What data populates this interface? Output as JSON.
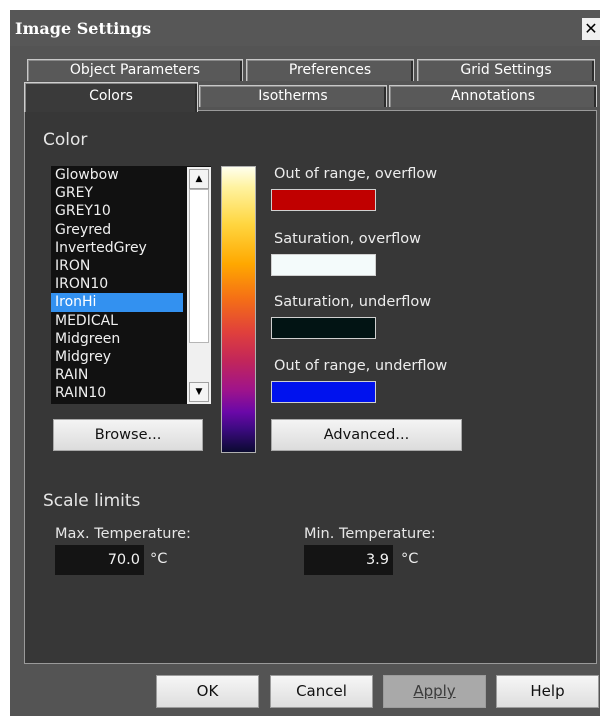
{
  "window": {
    "title": "Image Settings",
    "close_label": "✕"
  },
  "tabs_row1": [
    {
      "label": "Object Parameters"
    },
    {
      "label": "Preferences"
    },
    {
      "label": "Grid Settings"
    }
  ],
  "tabs_row2": [
    {
      "label": "Colors",
      "active": true
    },
    {
      "label": "Isotherms"
    },
    {
      "label": "Annotations"
    }
  ],
  "color_section": {
    "title": "Color",
    "palettes": [
      "Glowbow",
      "GREY",
      "GREY10",
      "Greyred",
      "InvertedGrey",
      "IRON",
      "IRON10",
      "IronHi",
      "MEDICAL",
      "Midgreen",
      "Midgrey",
      "RAIN",
      "RAIN10"
    ],
    "selected_palette": "IronHi",
    "scroll_up_icon": "▲",
    "scroll_down_icon": "▼",
    "browse_label": "Browse...",
    "advanced_label": "Advanced...",
    "swatches": [
      {
        "label": "Out of range, overflow",
        "color": "#c00000"
      },
      {
        "label": "Saturation, overflow",
        "color": "#f4fbfb"
      },
      {
        "label": "Saturation, underflow",
        "color": "#021414"
      },
      {
        "label": "Out of range, underflow",
        "color": "#0012ee"
      }
    ]
  },
  "scale_limits": {
    "title": "Scale limits",
    "max_label": "Max. Temperature:",
    "max_value": "70.0",
    "min_label": "Min. Temperature:",
    "min_value": "3.9",
    "unit": "°C"
  },
  "buttons": {
    "ok": "OK",
    "cancel": "Cancel",
    "apply": "Apply",
    "help": "Help"
  }
}
